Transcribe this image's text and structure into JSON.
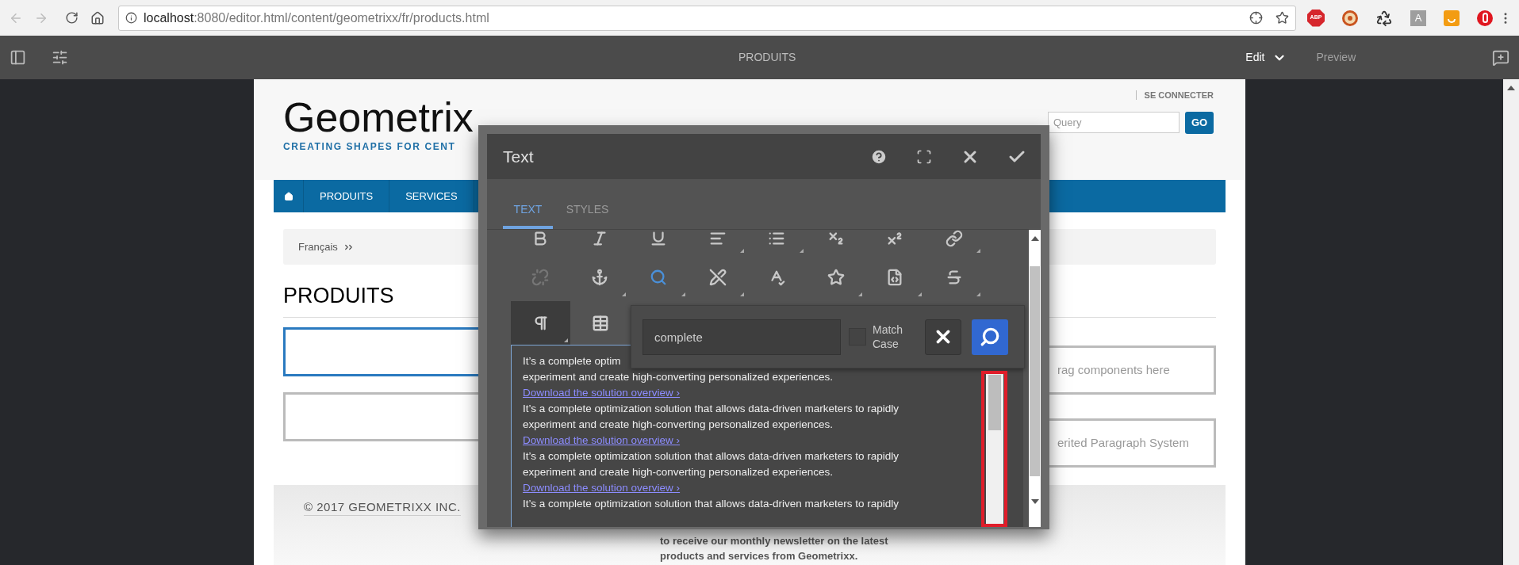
{
  "browser": {
    "url": {
      "host": "localhost",
      "path": ":8080/editor.html/content/geometrixx/fr/products.html"
    },
    "extensions": [
      {
        "kind": "abp",
        "label": "ABP"
      },
      {
        "kind": "round"
      },
      {
        "kind": "recycle"
      },
      {
        "kind": "letter",
        "label": "A"
      },
      {
        "kind": "orange"
      },
      {
        "kind": "opera"
      }
    ]
  },
  "editor_bar": {
    "title": "PRODUITS",
    "mode": "Edit",
    "preview": "Preview"
  },
  "site": {
    "logo": "Geometrix",
    "tagline": "CREATING SHAPES FOR CENT",
    "login": "SE CONNECTER",
    "search": {
      "placeholder": "Query"
    },
    "go": "GO",
    "nav": [
      {
        "label": "PRODUITS"
      },
      {
        "label": "SERVICES"
      }
    ],
    "breadcrumb": "Français",
    "heading": "PRODUITS",
    "left_boxes": [
      {
        "selected": true
      },
      {
        "selected": false
      }
    ],
    "right_boxes": [
      "rag components here",
      "erited Paragraph System"
    ],
    "copyright": "© 2017 GEOMETRIXX INC.",
    "newsletter": "to receive our monthly newsletter on the latest products and services from Geometrixx."
  },
  "dialog": {
    "title": "Text",
    "tabs": [
      {
        "label": "TEXT",
        "selected": true
      },
      {
        "label": "STYLES",
        "selected": false
      }
    ],
    "toolbar": [
      {
        "kind": "bold",
        "active": false,
        "disabled": false,
        "menu": false
      },
      {
        "kind": "italic",
        "active": false,
        "disabled": false,
        "menu": false
      },
      {
        "kind": "underline",
        "active": false,
        "disabled": false,
        "menu": false
      },
      {
        "kind": "align",
        "active": false,
        "disabled": false,
        "menu": true
      },
      {
        "kind": "list",
        "active": false,
        "disabled": false,
        "menu": true
      },
      {
        "kind": "subscript",
        "active": false,
        "disabled": false,
        "menu": false
      },
      {
        "kind": "superscript",
        "active": false,
        "disabled": false,
        "menu": false
      },
      {
        "kind": "link",
        "active": false,
        "disabled": false,
        "menu": true
      },
      {
        "kind": "unlink",
        "active": false,
        "disabled": true,
        "menu": false
      },
      {
        "kind": "anchor",
        "active": false,
        "disabled": false,
        "menu": true
      },
      {
        "kind": "find",
        "active": true,
        "disabled": false,
        "menu": true
      },
      {
        "kind": "edit",
        "active": false,
        "disabled": false,
        "menu": true
      },
      {
        "kind": "spellcheck",
        "active": false,
        "disabled": false,
        "menu": false
      },
      {
        "kind": "star",
        "active": false,
        "disabled": false,
        "menu": true
      },
      {
        "kind": "source",
        "active": false,
        "disabled": false,
        "menu": true
      },
      {
        "kind": "special",
        "active": false,
        "disabled": false,
        "menu": true
      }
    ],
    "format_buttons": [
      {
        "kind": "paragraph",
        "selected": true,
        "menu": true
      },
      {
        "kind": "table",
        "selected": false,
        "menu": false
      }
    ],
    "find": {
      "value": "complete",
      "match_case": {
        "label": "Match Case",
        "checked": false
      }
    },
    "content": {
      "partial_line": "It’s a complete optim",
      "paragraphs": [
        {
          "text": "experiment and create high-converting personalized experiences.",
          "link": "Download the solution overview ›"
        },
        {
          "text": "It’s a complete optimization solution that allows data-driven marketers to rapidly experiment and create high-converting personalized experiences.",
          "link": "Download the solution overview ›"
        },
        {
          "text": "It’s a complete optimization solution that allows data-driven marketers to rapidly experiment and create high-converting personalized experiences.",
          "link": "Download the solution overview ›"
        },
        {
          "text": "It’s a complete optimization solution that allows data-driven marketers to rapidly"
        }
      ]
    }
  }
}
